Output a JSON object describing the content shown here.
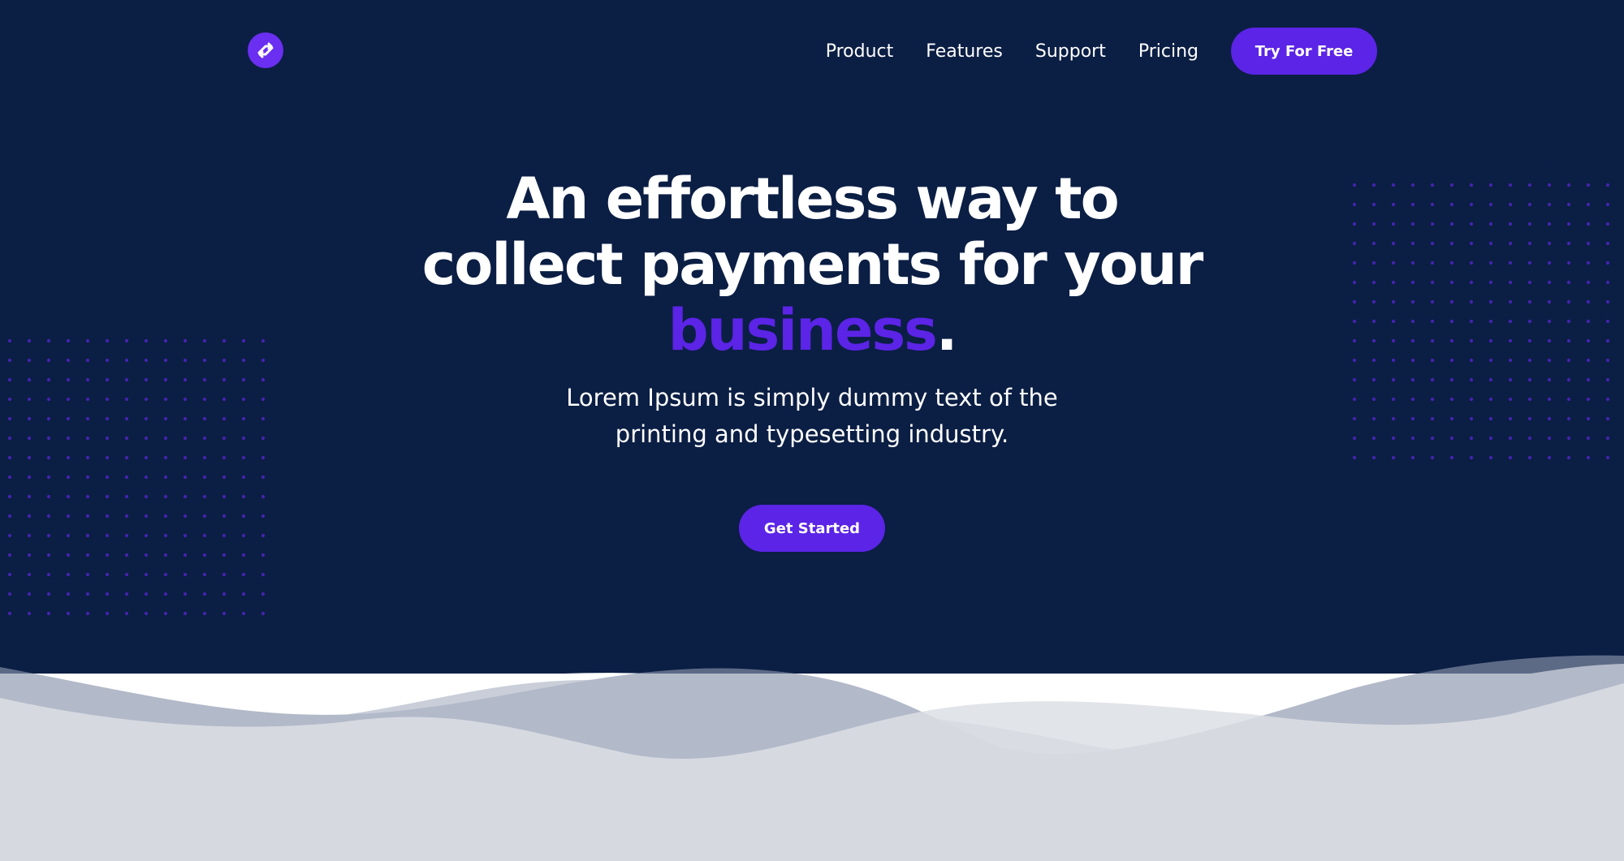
{
  "colors": {
    "hero_background": "#0b1e44",
    "accent": "#5b24e6",
    "dot_pattern": "#4423b0",
    "text": "#ffffff"
  },
  "header": {
    "logo_icon": "swap-arrows-icon",
    "nav": [
      {
        "label": "Product"
      },
      {
        "label": "Features"
      },
      {
        "label": "Support"
      },
      {
        "label": "Pricing"
      }
    ],
    "cta_label": "Try For Free"
  },
  "hero": {
    "headline_line1": "An effortless way to",
    "headline_line2": "collect payments for your",
    "headline_accent": "business",
    "headline_period": ".",
    "subtitle_line1": "Lorem Ipsum is simply dummy text of the",
    "subtitle_line2": "printing and typesetting industry.",
    "cta_label": "Get Started"
  }
}
